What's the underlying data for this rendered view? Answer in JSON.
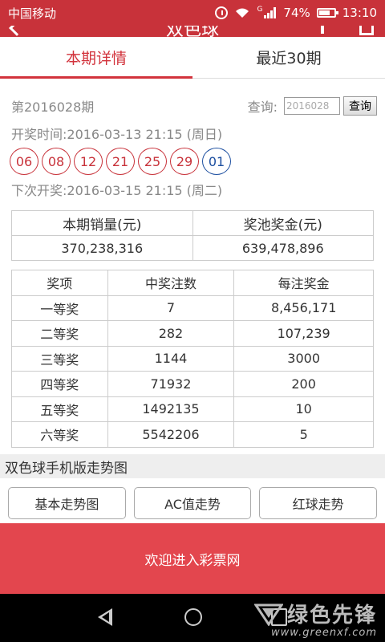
{
  "status_bar": {
    "carrier": "中国移动",
    "network": "G",
    "battery": "74%",
    "battery_level": 0.74,
    "time": "13:10"
  },
  "app_bar": {
    "title": "双色球"
  },
  "tabs": [
    {
      "label": "本期详情",
      "active": true
    },
    {
      "label": "最近30期",
      "active": false
    }
  ],
  "issue": {
    "issue_text": "第2016028期",
    "query_label": "查询:",
    "query_value": "2016028",
    "query_button": "查询",
    "draw_time": "开奖时间:2016-03-13 21:15 (周日)",
    "next_draw": "下次开奖:2016-03-15 21:15 (周二)"
  },
  "balls": {
    "red": [
      "06",
      "08",
      "12",
      "21",
      "25",
      "29"
    ],
    "blue": [
      "01"
    ],
    "red_color": "#c8323a",
    "blue_color": "#1d4fa0"
  },
  "sales": {
    "headers": [
      "本期销量(元)",
      "奖池奖金(元)"
    ],
    "values": [
      "370,238,316",
      "639,478,896"
    ]
  },
  "prizes": {
    "headers": [
      "奖项",
      "中奖注数",
      "每注奖金"
    ],
    "rows": [
      [
        "一等奖",
        "7",
        "8,456,171"
      ],
      [
        "二等奖",
        "282",
        "107,239"
      ],
      [
        "三等奖",
        "1144",
        "3000"
      ],
      [
        "四等奖",
        "71932",
        "200"
      ],
      [
        "五等奖",
        "1492135",
        "10"
      ],
      [
        "六等奖",
        "5542206",
        "5"
      ]
    ]
  },
  "chart_section": {
    "title": "双色球手机版走势图",
    "buttons": [
      "基本走势图",
      "AC值走势",
      "红球走势"
    ]
  },
  "banner": {
    "text": "欢迎进入彩票网"
  },
  "watermark": {
    "name": "绿色先锋",
    "url": "www.greenxf.com"
  },
  "colors": {
    "accent": "#c8323a",
    "banner": "#e3464e"
  }
}
